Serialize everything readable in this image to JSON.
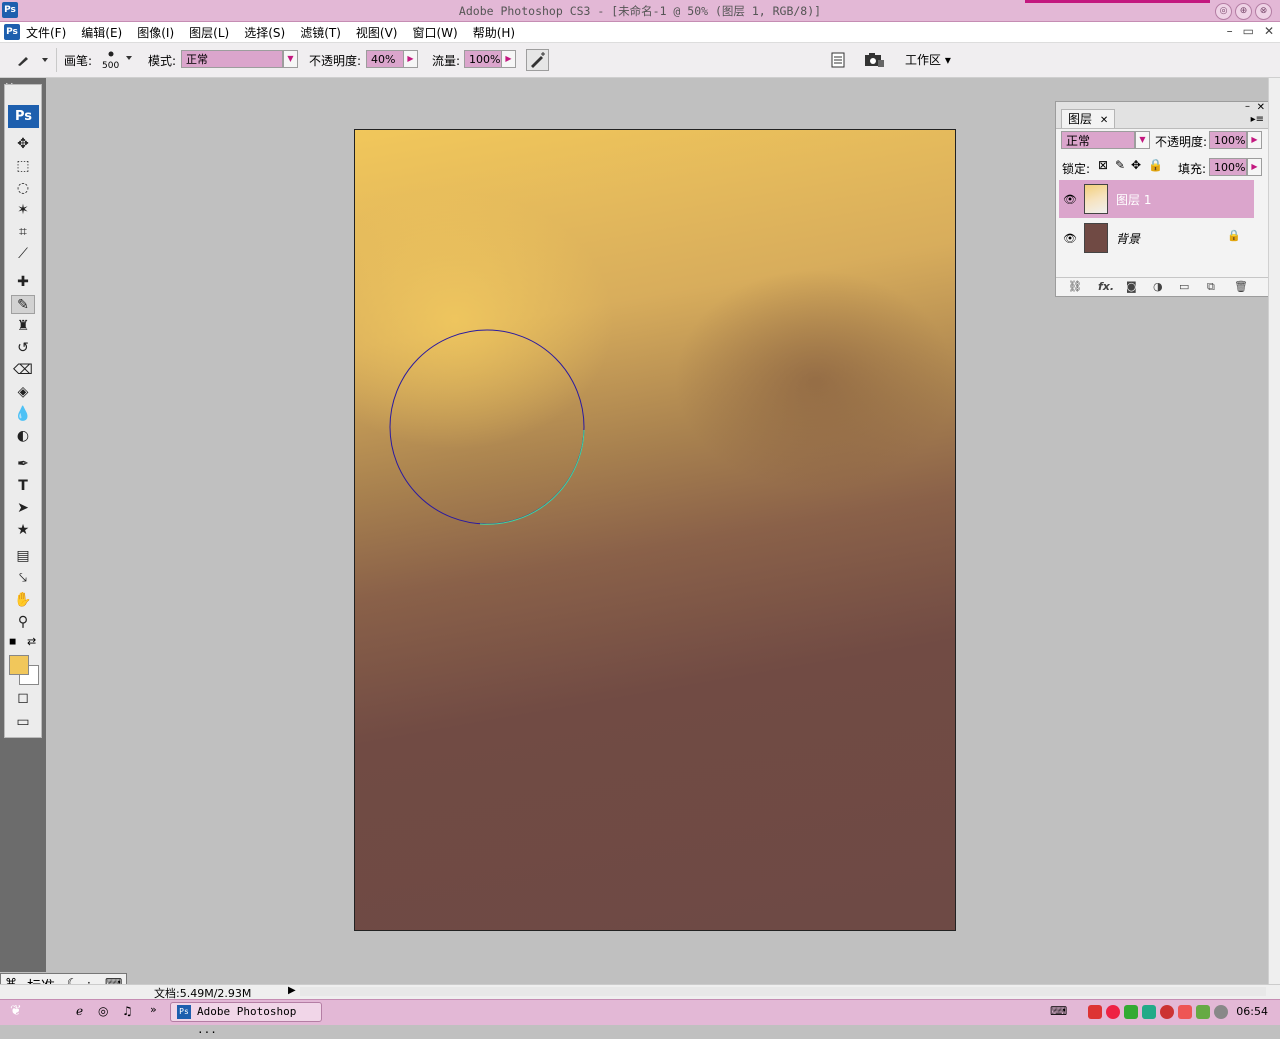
{
  "window": {
    "title": "Adobe Photoshop CS3 - [未命名-1 @ 50% (图层 1, RGB/8)]",
    "buttons": [
      "◎",
      "⊕",
      "⊗"
    ]
  },
  "menu": {
    "items": [
      "文件(F)",
      "编辑(E)",
      "图像(I)",
      "图层(L)",
      "选择(S)",
      "滤镜(T)",
      "视图(V)",
      "窗口(W)",
      "帮助(H)"
    ],
    "controls": [
      "–",
      "▭",
      "✕"
    ]
  },
  "options": {
    "brush_label": "画笔:",
    "brush_size": "500",
    "mode_label": "模式:",
    "mode_value": "正常",
    "opacity_label": "不透明度:",
    "opacity_value": "40%",
    "flow_label": "流量:",
    "flow_value": "100%",
    "workspace_label": "工作区 ▾"
  },
  "tools": {
    "logo": "Ps",
    "active_tool": "brush",
    "foreground_color": "#f1c75b",
    "background_color": "#ffffff"
  },
  "layers_panel": {
    "tab": "图层",
    "blend_mode": "正常",
    "opacity_label": "不透明度:",
    "opacity_value": "100%",
    "lock_label": "锁定:",
    "fill_label": "填充:",
    "fill_value": "100%",
    "layers": [
      {
        "name": "图层 1",
        "selected": true,
        "locked": false
      },
      {
        "name": "背景",
        "selected": false,
        "locked": true
      }
    ],
    "footer_icons": [
      "link-icon",
      "fx-icon",
      "mask-icon",
      "adjustment-icon",
      "folder-icon",
      "new-layer-icon",
      "trash-icon"
    ],
    "footer_fx": "fx."
  },
  "status": {
    "doc_size": "文档:5.49M/2.93M"
  },
  "ime": {
    "mode": "标准"
  },
  "taskbar": {
    "task_label": "Adobe Photoshop ...",
    "clock": "06:54"
  },
  "colors": {
    "accent": "#dba5cc",
    "titlebar": "#e3b8d6",
    "canvas_top": "#f1c75b",
    "canvas_bottom": "#6e4a45",
    "brush_cursor": "#2a1aa0",
    "brush_cursor_alt": "#40d8a0"
  }
}
